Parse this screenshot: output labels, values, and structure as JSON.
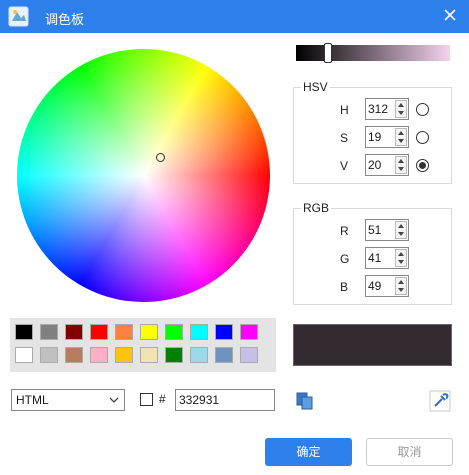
{
  "window": {
    "title": "调色板"
  },
  "hsv": {
    "title": "HSV",
    "h_label": "H",
    "h_value": "312",
    "s_label": "S",
    "s_value": "19",
    "v_label": "V",
    "v_value": "20"
  },
  "rgb": {
    "title": "RGB",
    "r_label": "R",
    "r_value": "51",
    "g_label": "G",
    "g_value": "41",
    "b_label": "B",
    "b_value": "49"
  },
  "swatches": [
    "#000000",
    "#808080",
    "#800000",
    "#ff0000",
    "#ff8040",
    "#ffff00",
    "#00ff00",
    "#00ffff",
    "#0000ff",
    "#ff00ff",
    "#ffffff",
    "#c0c0c0",
    "#b87d5e",
    "#ffafc8",
    "#ffc20e",
    "#efe4b0",
    "#008000",
    "#99d9ea",
    "#7092be",
    "#c8bfe7"
  ],
  "current_color": "#332931",
  "format": {
    "selected": "HTML"
  },
  "hex": {
    "prefix": "#",
    "value": "332931"
  },
  "buttons": {
    "ok": "确定",
    "cancel": "取消"
  },
  "colors": {
    "accent": "#2d80ec"
  },
  "icons": {
    "app": "palette-app-icon",
    "close": "close-icon",
    "copy": "copy-icon",
    "eyedropper": "eyedropper-icon"
  }
}
